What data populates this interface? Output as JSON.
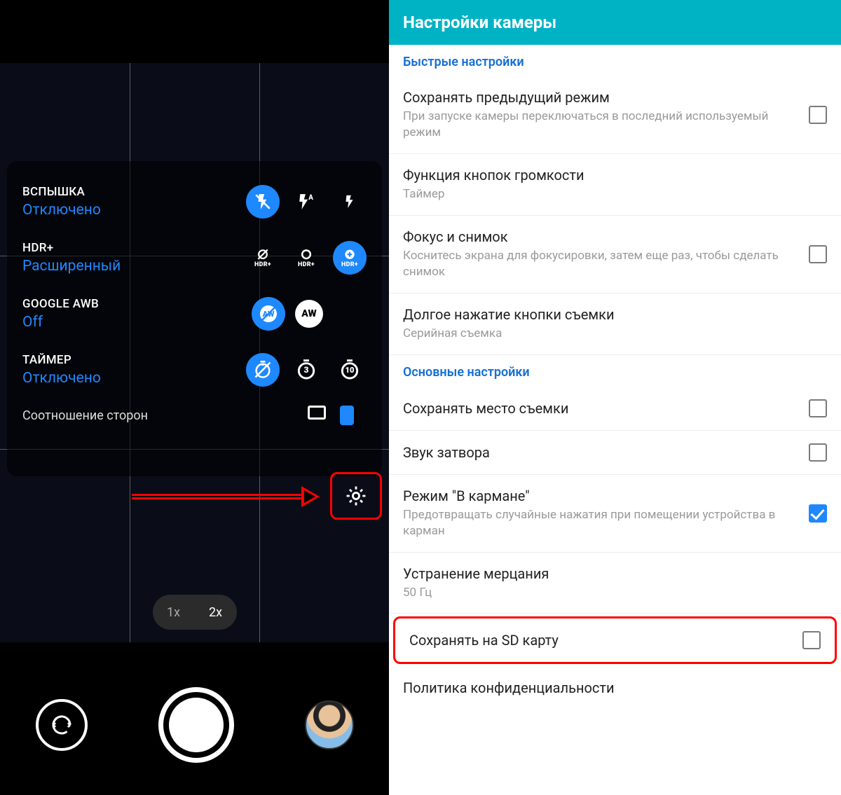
{
  "camera": {
    "quick": [
      {
        "label": "ВСПЫШКА",
        "value": "Отключено"
      },
      {
        "label": "HDR+",
        "value": "Расширенный"
      },
      {
        "label": "GOOGLE AWB",
        "value": "Off"
      },
      {
        "label": "ТАЙМЕР",
        "value": "Отключено"
      }
    ],
    "aspect_label": "Соотношение сторон",
    "hdr_tag": "HDR+",
    "timer_3": "3",
    "timer_10": "10",
    "awb_tag": "AW",
    "zoom": {
      "opt1": "1x",
      "opt2": "2x"
    }
  },
  "settings": {
    "header": "Настройки камеры",
    "section_quick": "Быстрые настройки",
    "section_main": "Основные настройки",
    "items": [
      {
        "title": "Сохранять предыдущий режим",
        "sub": "При запуске камеры переключаться в последний используемый режим",
        "check": false
      },
      {
        "title": "Функция кнопок громкости",
        "sub": "Таймер",
        "check": null
      },
      {
        "title": "Фокус и снимок",
        "sub": "Коснитесь экрана для фокусировки, затем еще раз, чтобы сделать снимок",
        "check": false
      },
      {
        "title": "Долгое нажатие кнопки съемки",
        "sub": "Серийная съемка",
        "check": null
      },
      {
        "title": "Сохранять место съемки",
        "sub": "",
        "check": false
      },
      {
        "title": "Звук затвора",
        "sub": "",
        "check": false
      },
      {
        "title": "Режим \"В кармане\"",
        "sub": "Предотвращать случайные нажатия при помещении устройства в карман",
        "check": true
      },
      {
        "title": "Устранение мерцания",
        "sub": "50 Гц",
        "check": null
      },
      {
        "title": "Сохранять на SD карту",
        "sub": "",
        "check": false
      },
      {
        "title": "Политика конфиденциальности",
        "sub": "",
        "check": null
      }
    ]
  }
}
